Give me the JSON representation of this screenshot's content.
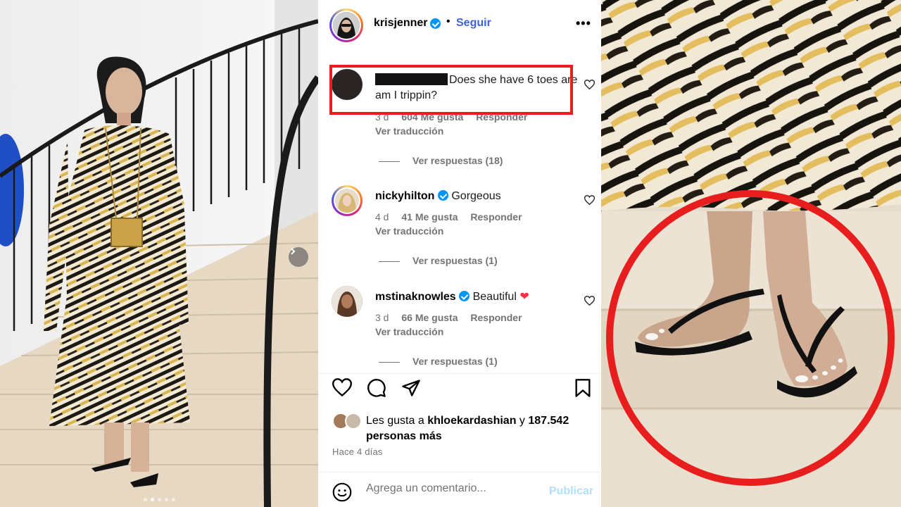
{
  "post": {
    "username": "krisjenner",
    "separator": "•",
    "follow_label": "Seguir",
    "more_label": "•••",
    "likes_prefix": "Les gusta a",
    "likes_user": "khloekardashian",
    "likes_connector": "y",
    "likes_count": "187.542",
    "likes_suffix": "personas más",
    "time": "Hace 4 días"
  },
  "comments": [
    {
      "username": "",
      "text": "Does she have 6 toes are am I trippin?",
      "age": "3 d",
      "likes": "604 Me gusta",
      "reply": "Responder",
      "translate": "Ver traducción",
      "replies": "Ver respuestas (18)"
    },
    {
      "username": "nickyhilton",
      "text": "Gorgeous",
      "age": "4 d",
      "likes": "41 Me gusta",
      "reply": "Responder",
      "translate": "Ver traducción",
      "replies": "Ver respuestas (1)"
    },
    {
      "username": "mstinaknowles",
      "text": "Beautiful",
      "emoji": "❤",
      "age": "3 d",
      "likes": "66 Me gusta",
      "reply": "Responder",
      "translate": "Ver traducción",
      "replies": "Ver respuestas (1)"
    }
  ],
  "comment_box": {
    "placeholder": "Agrega un comentario...",
    "publish_label": "Publicar"
  },
  "carousel": {
    "total_slides": 5,
    "active_index": 1
  },
  "colors": {
    "follow_blue": "#3f63d6",
    "verified_blue": "#0095f6",
    "highlight_red": "#e81d1d",
    "heart_red": "#ff3040",
    "meta_gray": "#737373"
  },
  "icons": {
    "like": "heart-outline",
    "comment": "speech-bubble",
    "share": "paper-plane",
    "save": "bookmark",
    "emoji": "smiley-face"
  }
}
